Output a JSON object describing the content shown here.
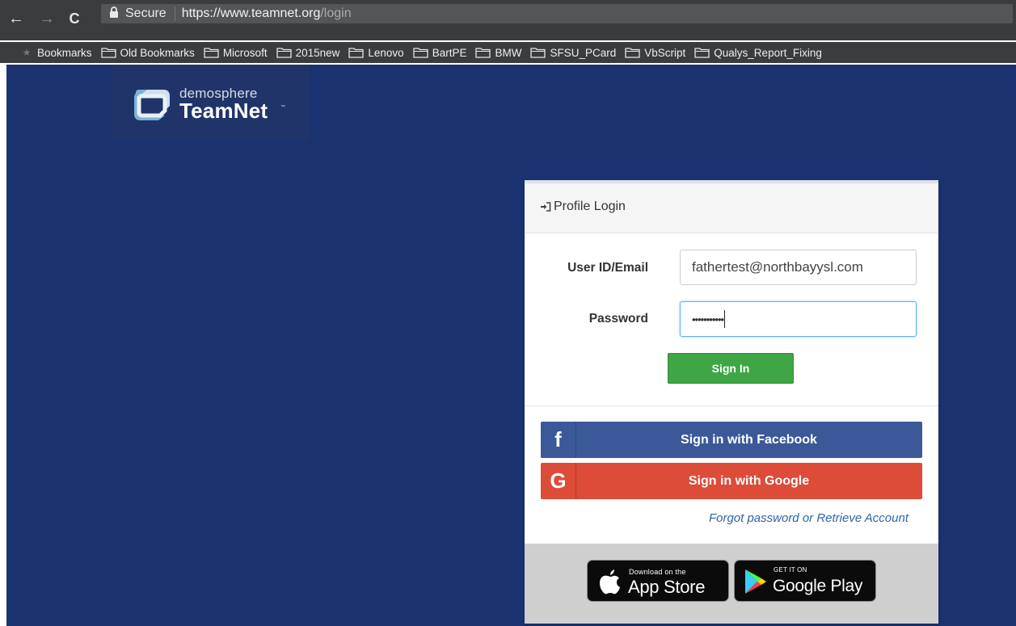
{
  "browser": {
    "back_glyph": "←",
    "forward_glyph": "→",
    "reload_glyph": "C",
    "secure_label": "Secure",
    "url_host": "https://www.teamnet.org",
    "url_path": "/login"
  },
  "bookmarks": {
    "items": [
      {
        "label": "Bookmarks",
        "icon": "none"
      },
      {
        "label": "Old Bookmarks",
        "icon": "folder-icon"
      },
      {
        "label": "Microsoft",
        "icon": "folder-icon"
      },
      {
        "label": "2015new",
        "icon": "folder-icon"
      },
      {
        "label": "Lenovo",
        "icon": "folder-icon"
      },
      {
        "label": "BartPE",
        "icon": "folder-icon"
      },
      {
        "label": "BMW",
        "icon": "folder-icon"
      },
      {
        "label": "SFSU_PCard",
        "icon": "folder-icon"
      },
      {
        "label": "VbScript",
        "icon": "folder-icon"
      },
      {
        "label": "Qualys_Report_Fixing",
        "icon": "folder-icon"
      }
    ]
  },
  "logo": {
    "small_text": "demosphere",
    "big_text": "TeamNet",
    "tm": "™"
  },
  "login": {
    "header_title": "Profile Login",
    "header_icon": "sign-in-icon",
    "user_label": "User ID/Email",
    "user_value": "fathertest@northbayysl.com",
    "password_label": "Password",
    "password_value": "•••••••••••",
    "sign_in_label": "Sign In",
    "facebook_label": "Sign in with Facebook",
    "facebook_icon_glyph": "f",
    "google_label": "Sign in with Google",
    "google_icon_glyph": "G",
    "forgot_link": "Forgot password or Retrieve Account"
  },
  "stores": {
    "apple_small": "Download on the",
    "apple_big": "App Store",
    "google_small": "GET IT ON",
    "google_big": "Google Play"
  },
  "colors": {
    "page_background": "#1a3370",
    "sign_in_button": "#3ea645",
    "facebook": "#3b5998",
    "google": "#dd4b39",
    "link": "#2f65a7"
  }
}
